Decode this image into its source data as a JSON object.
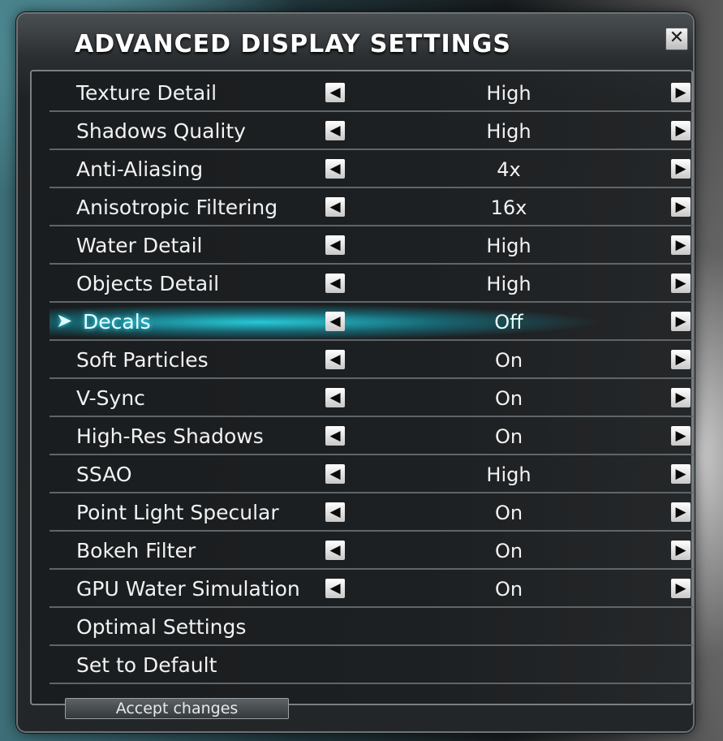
{
  "dialog": {
    "title": "ADVANCED DISPLAY SETTINGS",
    "close_glyph": "✕"
  },
  "settings": [
    {
      "label": "Texture Detail",
      "value": "High"
    },
    {
      "label": "Shadows Quality",
      "value": "High"
    },
    {
      "label": "Anti-Aliasing",
      "value": "4x"
    },
    {
      "label": "Anisotropic Filtering",
      "value": "16x"
    },
    {
      "label": "Water Detail",
      "value": "High"
    },
    {
      "label": "Objects Detail",
      "value": "High"
    },
    {
      "label": "Decals",
      "value": "Off",
      "selected": true
    },
    {
      "label": "Soft Particles",
      "value": "On"
    },
    {
      "label": "V-Sync",
      "value": "On"
    },
    {
      "label": "High-Res Shadows",
      "value": "On"
    },
    {
      "label": "SSAO",
      "value": "High"
    },
    {
      "label": "Point Light Specular",
      "value": "On"
    },
    {
      "label": "Bokeh Filter",
      "value": "On"
    },
    {
      "label": "GPU Water Simulation",
      "value": "On"
    }
  ],
  "actions": [
    {
      "label": "Optimal Settings"
    },
    {
      "label": "Set to Default"
    }
  ],
  "footer": {
    "accept_label": "Accept changes"
  },
  "icons": {
    "left_arrow": "◀",
    "right_arrow": "▶",
    "selection_pointer": "➤"
  },
  "colors": {
    "highlight": "#2fd4e6",
    "text": "#f2f2f2"
  }
}
